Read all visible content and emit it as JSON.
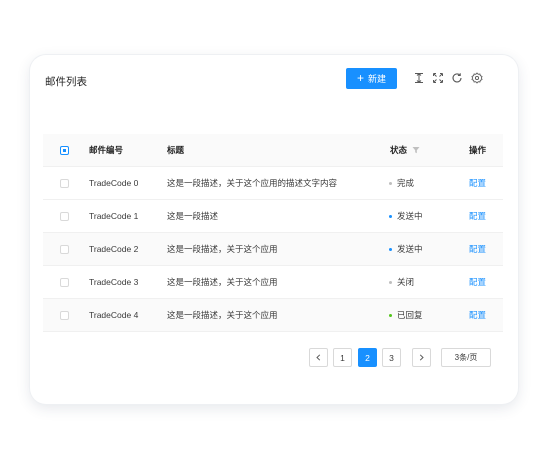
{
  "title": "邮件列表",
  "toolbar": {
    "new_label": "新建",
    "icons": [
      "column-height-icon",
      "fullscreen-icon",
      "reload-icon",
      "setting-icon"
    ]
  },
  "table": {
    "columns": [
      "邮件编号",
      "标题",
      "状态",
      "操作"
    ],
    "rows": [
      {
        "code": "TradeCode 0",
        "title": "这是一段描述，关于这个应用的描述文字内容",
        "status": "完成",
        "status_color": "#bfbfbf",
        "action": "配置"
      },
      {
        "code": "TradeCode 1",
        "title": "这是一段描述",
        "status": "发送中",
        "status_color": "#1890ff",
        "action": "配置"
      },
      {
        "code": "TradeCode 2",
        "title": "这是一段描述，关于这个应用",
        "status": "发送中",
        "status_color": "#1890ff",
        "action": "配置"
      },
      {
        "code": "TradeCode 3",
        "title": "这是一段描述，关于这个应用",
        "status": "关闭",
        "status_color": "#bfbfbf",
        "action": "配置"
      },
      {
        "code": "TradeCode 4",
        "title": "这是一段描述，关于这个应用",
        "status": "已回复",
        "status_color": "#52c41a",
        "action": "配置"
      }
    ]
  },
  "pagination": {
    "pages": [
      "1",
      "2",
      "3"
    ],
    "current": "2",
    "page_size": "3条/页"
  },
  "colors": {
    "accent": "#1890ff"
  }
}
